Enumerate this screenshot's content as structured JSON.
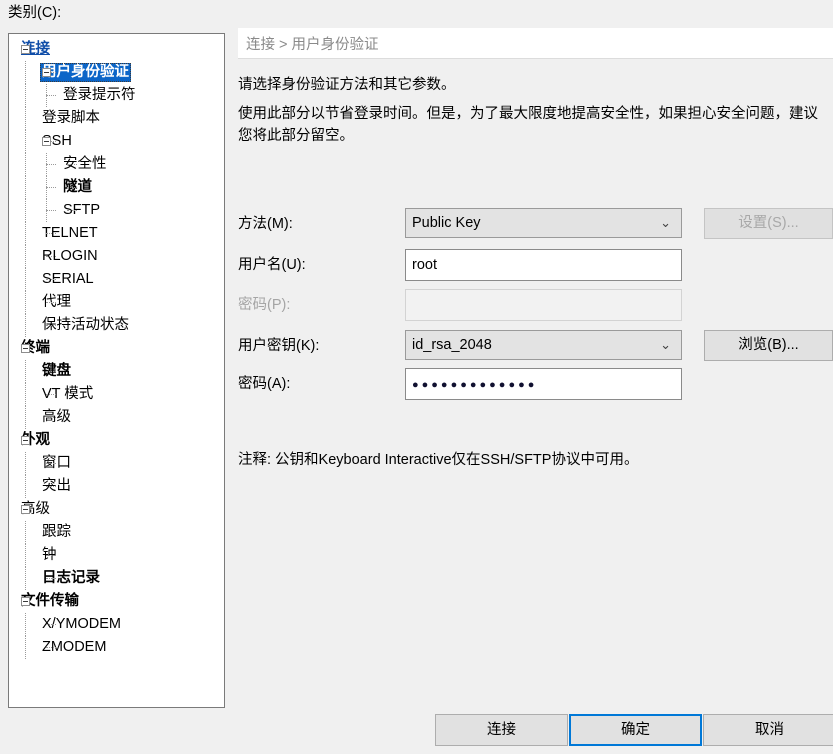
{
  "dialog": {
    "category_label": "类别(C):"
  },
  "tree": {
    "items": [
      {
        "label": "连接",
        "level": 0,
        "style": "link",
        "expander": true,
        "icon": "tree-expander-collapse-icon"
      },
      {
        "label": "用户身份验证",
        "level": 1,
        "style": "selected",
        "expander": true,
        "icon": "tree-expander-collapse-icon"
      },
      {
        "label": "登录提示符",
        "level": 2,
        "style": "normal",
        "expander": false,
        "icon": ""
      },
      {
        "label": "登录脚本",
        "level": 1,
        "style": "normal",
        "expander": false,
        "icon": ""
      },
      {
        "label": "SSH",
        "level": 1,
        "style": "normal",
        "expander": true,
        "icon": "tree-expander-collapse-icon"
      },
      {
        "label": "安全性",
        "level": 2,
        "style": "normal",
        "expander": false,
        "icon": ""
      },
      {
        "label": "隧道",
        "level": 2,
        "style": "bold",
        "expander": false,
        "icon": ""
      },
      {
        "label": "SFTP",
        "level": 2,
        "style": "normal",
        "expander": false,
        "icon": ""
      },
      {
        "label": "TELNET",
        "level": 1,
        "style": "normal",
        "expander": false,
        "icon": ""
      },
      {
        "label": "RLOGIN",
        "level": 1,
        "style": "normal",
        "expander": false,
        "icon": ""
      },
      {
        "label": "SERIAL",
        "level": 1,
        "style": "normal",
        "expander": false,
        "icon": ""
      },
      {
        "label": "代理",
        "level": 1,
        "style": "normal",
        "expander": false,
        "icon": ""
      },
      {
        "label": "保持活动状态",
        "level": 1,
        "style": "normal",
        "expander": false,
        "icon": ""
      },
      {
        "label": "终端",
        "level": 0,
        "style": "bold",
        "expander": true,
        "icon": "tree-expander-collapse-icon"
      },
      {
        "label": "键盘",
        "level": 1,
        "style": "bold",
        "expander": false,
        "icon": ""
      },
      {
        "label": "VT 模式",
        "level": 1,
        "style": "normal",
        "expander": false,
        "icon": ""
      },
      {
        "label": "高级",
        "level": 1,
        "style": "normal",
        "expander": false,
        "icon": ""
      },
      {
        "label": "外观",
        "level": 0,
        "style": "bold",
        "expander": true,
        "icon": "tree-expander-collapse-icon"
      },
      {
        "label": "窗口",
        "level": 1,
        "style": "normal",
        "expander": false,
        "icon": ""
      },
      {
        "label": "突出",
        "level": 1,
        "style": "normal",
        "expander": false,
        "icon": ""
      },
      {
        "label": "高级",
        "level": 0,
        "style": "normal",
        "expander": true,
        "icon": "tree-expander-collapse-icon"
      },
      {
        "label": "跟踪",
        "level": 1,
        "style": "normal",
        "expander": false,
        "icon": ""
      },
      {
        "label": "钟",
        "level": 1,
        "style": "normal",
        "expander": false,
        "icon": ""
      },
      {
        "label": "日志记录",
        "level": 1,
        "style": "bold",
        "expander": false,
        "icon": ""
      },
      {
        "label": "文件传输",
        "level": 0,
        "style": "bold",
        "expander": true,
        "icon": "tree-expander-collapse-icon"
      },
      {
        "label": "X/YMODEM",
        "level": 1,
        "style": "normal",
        "expander": false,
        "icon": ""
      },
      {
        "label": "ZMODEM",
        "level": 1,
        "style": "normal",
        "expander": false,
        "icon": ""
      }
    ]
  },
  "panel": {
    "breadcrumb": "连接 > 用户身份验证",
    "description_1": "请选择身份验证方法和其它参数。",
    "description_2": "使用此部分以节省登录时间。但是，为了最大限度地提高安全性，如果担心安全问题，建议您将此部分留空。",
    "note": "注释: 公钥和Keyboard Interactive仅在SSH/SFTP协议中可用。",
    "fields": {
      "method": {
        "label": "方法(M):",
        "value": "Public Key",
        "chevron": "⌄",
        "button_label": "设置(S)...",
        "button_disabled": true
      },
      "username": {
        "label": "用户名(U):",
        "value": "root",
        "placeholder": ""
      },
      "password": {
        "label": "密码(P):",
        "value": "",
        "placeholder": "",
        "disabled": true
      },
      "userkey": {
        "label": "用户密钥(K):",
        "value": "id_rsa_2048",
        "chevron": "⌄",
        "button_label": "浏览(B)...",
        "button_disabled": false
      },
      "passphrase": {
        "label": "密码(A):",
        "value": "●●●●●●●●●●●●●"
      }
    }
  },
  "footer": {
    "connect_label": "连接",
    "ok_label": "确定",
    "cancel_label": "取消"
  },
  "colors": {
    "selection_blue": "#0b65c8",
    "link_blue": "#0f4da8",
    "focus_blue": "#0078d7",
    "dialog_bg": "#f0f0f0",
    "field_bg": "#ffffff",
    "combo_bg": "#e3e3e3"
  }
}
